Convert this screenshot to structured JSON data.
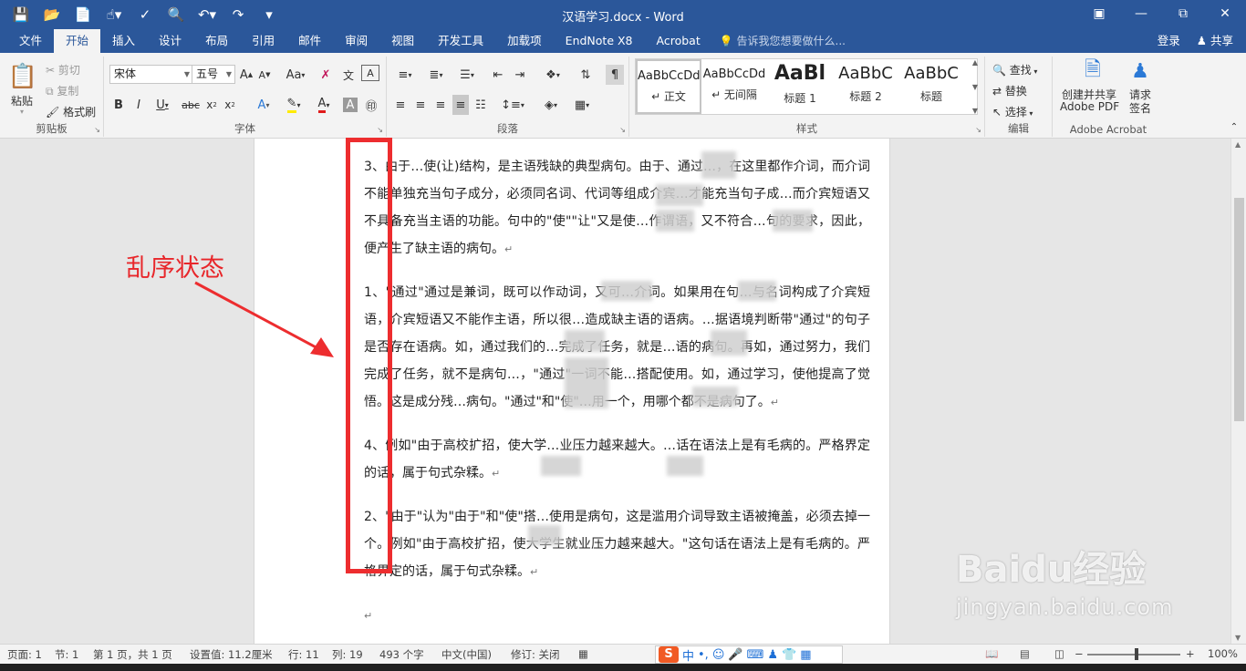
{
  "title_bar": {
    "title": "汉语学习.docx - Word",
    "qat_icons": [
      "save-icon",
      "open-folder-icon",
      "new-doc-icon",
      "touch-mode-icon",
      "spelling-icon",
      "print-preview-icon",
      "undo-icon",
      "redo-icon",
      "customize-qat-icon"
    ],
    "window_buttons": [
      "ribbon-display-icon",
      "minimize-icon",
      "restore-icon",
      "close-icon"
    ]
  },
  "tabs": [
    "文件",
    "开始",
    "插入",
    "设计",
    "布局",
    "引用",
    "邮件",
    "审阅",
    "视图",
    "开发工具",
    "加载项",
    "EndNote X8",
    "Acrobat"
  ],
  "active_tab": "开始",
  "tell_me": "告诉我您想要做什么...",
  "login": "登录",
  "share": "共享",
  "ribbon": {
    "clipboard": {
      "label": "剪贴板",
      "paste": "粘贴",
      "cut": "剪切",
      "copy": "复制",
      "format_painter": "格式刷"
    },
    "font": {
      "label": "字体",
      "font_name": "宋体",
      "font_size": "五号",
      "change_case": "Aa"
    },
    "paragraph": {
      "label": "段落"
    },
    "styles": {
      "label": "样式",
      "items": [
        {
          "sample": "AaBbCcDd",
          "name": "↵ 正文"
        },
        {
          "sample": "AaBbCcDd",
          "name": "↵ 无间隔"
        },
        {
          "sample": "AaBl",
          "name": "标题 1"
        },
        {
          "sample": "AaBbC",
          "name": "标题 2"
        },
        {
          "sample": "AaBbC",
          "name": "标题"
        }
      ]
    },
    "editing": {
      "label": "编辑",
      "find": "查找",
      "replace": "替换",
      "select": "选择"
    },
    "acrobat": {
      "label": "Adobe Acrobat",
      "create_pdf_line1": "创建并共享",
      "create_pdf_line2": "Adobe PDF",
      "request_line1": "请求",
      "request_line2": "签名"
    }
  },
  "document": {
    "paragraphs": [
      "3、由于…使(让)结构，是主语残缺的典型病句。由于、通过…，在这里都作介词，而介词不能单独充当句子成分，必须同名词、代词等组成介宾…才能充当句子成…而介宾短语又不具备充当主语的功能。句中的\"使\"\"让\"又是使…作谓语，又不符合…句的要求，因此，便产生了缺主语的病句。",
      "1、\"通过\"通过是兼词，既可以作动词，又可…介词。如果用在句…与名词构成了介宾短语，介宾短语又不能作主语，所以很…造成缺主语的语病。…据语境判断带\"通过\"的句子是否存在语病。如，通过我们的…完成了任务，就是…语的病句。再如，通过努力，我们完成了任务，就不是病句…，\"通过\"一词不能…搭配使用。如，通过学习，使他提高了觉悟。这是成分残…病句。\"通过\"和\"使\"…用一个，用哪个都不是病句了。",
      "4、例如\"由于高校扩招，使大学…业压力越来越大。…话在语法上是有毛病的。严格界定的话，属于句式杂糅。",
      "2、\"由于\"认为\"由于\"和\"使\"搭…使用是病句，这是滥用介词导致主语被掩盖，必须去掉一个。例如\"由于高校扩招，使大学生就业压力越来越大。\"这句话在语法上是有毛病的。严格界定的话，属于句式杂糅。"
    ],
    "para_mark": "↵"
  },
  "annotation": {
    "text": "乱序状态",
    "color": "#e8262a"
  },
  "watermark": {
    "line1": "Baidu经验",
    "line2": "jingyan.baidu.com"
  },
  "status_bar": {
    "page": "页面: 1",
    "section": "节: 1",
    "page_of": "第 1 页，共 1 页",
    "settings": "设置值: 11.2厘米",
    "line": "行: 11",
    "column": "列: 19",
    "word_count": "493 个字",
    "language": "中文(中国)",
    "track_changes": "修订: 关闭",
    "ime": "中",
    "zoom": "100%"
  },
  "colors": {
    "accent": "#2b579a",
    "annotation_red": "#ed2d2f"
  }
}
